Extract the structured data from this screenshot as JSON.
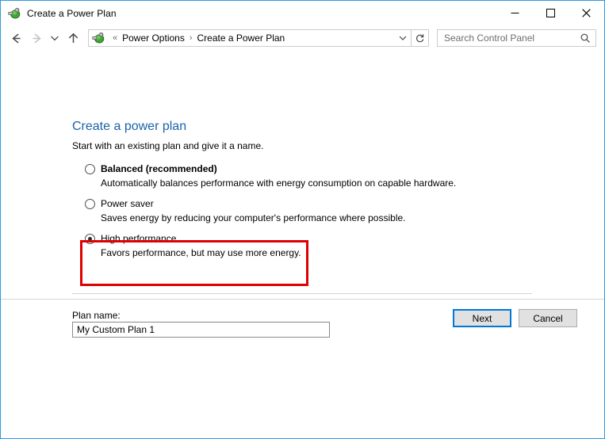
{
  "window": {
    "title": "Create a Power Plan",
    "icon": "power-options-icon",
    "accent_border": "#2e9bdf",
    "controls": {
      "minimize": "Minimize",
      "maximize": "Maximize",
      "close": "Close"
    }
  },
  "addressbar": {
    "back": "Back",
    "forward": "Forward",
    "recent": "Recent locations",
    "up": "Up one level",
    "icon": "power-options-icon",
    "separator_leading": "«",
    "crumbs": [
      "Power Options",
      "Create a Power Plan"
    ],
    "crumb_separator": "›",
    "dropdown": "Previous locations",
    "refresh": "Refresh"
  },
  "search": {
    "placeholder": "Search Control Panel",
    "value": "",
    "icon": "search-icon"
  },
  "main": {
    "title": "Create a power plan",
    "title_color": "#1963a8",
    "subtitle": "Start with an existing plan and give it a name.",
    "options": [
      {
        "label": "Balanced (recommended)",
        "description": "Automatically balances performance with energy consumption on capable hardware.",
        "selected": false,
        "bold": true
      },
      {
        "label": "Power saver",
        "description": "Saves energy by reducing your computer's performance where possible.",
        "selected": false,
        "bold": false
      },
      {
        "label": "High performance",
        "description": "Favors performance, but may use more energy.",
        "selected": true,
        "bold": false
      }
    ],
    "annotation": {
      "target": "High performance",
      "color": "#e00000"
    },
    "plan_name": {
      "label": "Plan name:",
      "value": "My Custom Plan 1"
    }
  },
  "footer": {
    "next_label": "Next",
    "cancel_label": "Cancel",
    "default_button": "Next",
    "focus_color": "#0078d7"
  }
}
